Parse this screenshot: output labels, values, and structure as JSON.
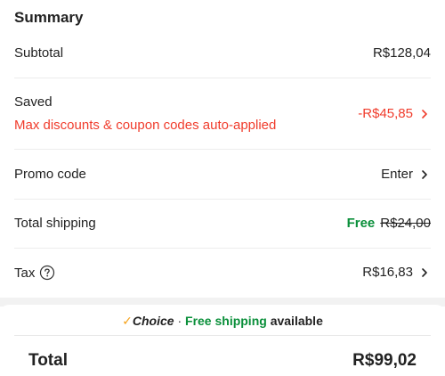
{
  "summary": {
    "title": "Summary",
    "subtotal": {
      "label": "Subtotal",
      "value": "R$128,04"
    },
    "saved": {
      "label": "Saved",
      "note": "Max discounts & coupon codes auto-applied",
      "value": "-R$45,85",
      "color": "#f03c2c"
    },
    "promo": {
      "label": "Promo code",
      "value": "Enter"
    },
    "shipping": {
      "label": "Total shipping",
      "free": "Free",
      "original": "R$24,00",
      "free_color": "#0a8f3a"
    },
    "tax": {
      "label": "Tax",
      "value": "R$16,83"
    }
  },
  "choice_banner": {
    "check": "✓",
    "choice": "Choice",
    "separator": " · ",
    "free_shipping": "Free shipping",
    "available": "available"
  },
  "total": {
    "label": "Total",
    "value": "R$99,02"
  }
}
